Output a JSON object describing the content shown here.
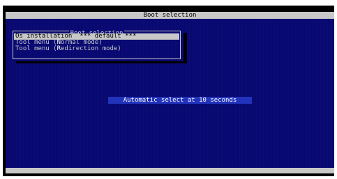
{
  "window": {
    "title": "Boot selection"
  },
  "menu": {
    "title": "Boot selection",
    "items": [
      {
        "hotkey": "O",
        "rest": "s installation  *** default ***",
        "selected": true
      },
      {
        "prefix": "Tool menu (",
        "hotkey": "N",
        "rest": "ormal mode)",
        "selected": false
      },
      {
        "prefix": "Tool menu (",
        "hotkey": "R",
        "rest": "edirection mode)",
        "selected": false
      }
    ]
  },
  "status": {
    "message": "Automatic select at 10 seconds"
  },
  "colors": {
    "background": "#0a0a7a",
    "bar": "#c8c8c8",
    "highlight": "#2233bb",
    "text": "#c8c8c8"
  }
}
